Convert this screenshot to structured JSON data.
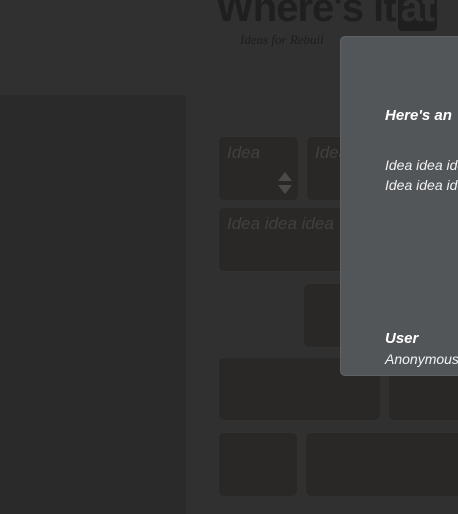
{
  "brand": {
    "title": "Where's it",
    "at_label": "at",
    "tagline": "Ideas for Rebuil"
  },
  "cards": {
    "c1_text": "Idea",
    "c2_text": "Idea",
    "c3_text": "Idea idea idea"
  },
  "modal": {
    "heading": "Here's an",
    "body_line1": "Idea idea ide",
    "body_line2": "Idea idea ide",
    "user_label": "User",
    "user_value": "Anonymous"
  }
}
